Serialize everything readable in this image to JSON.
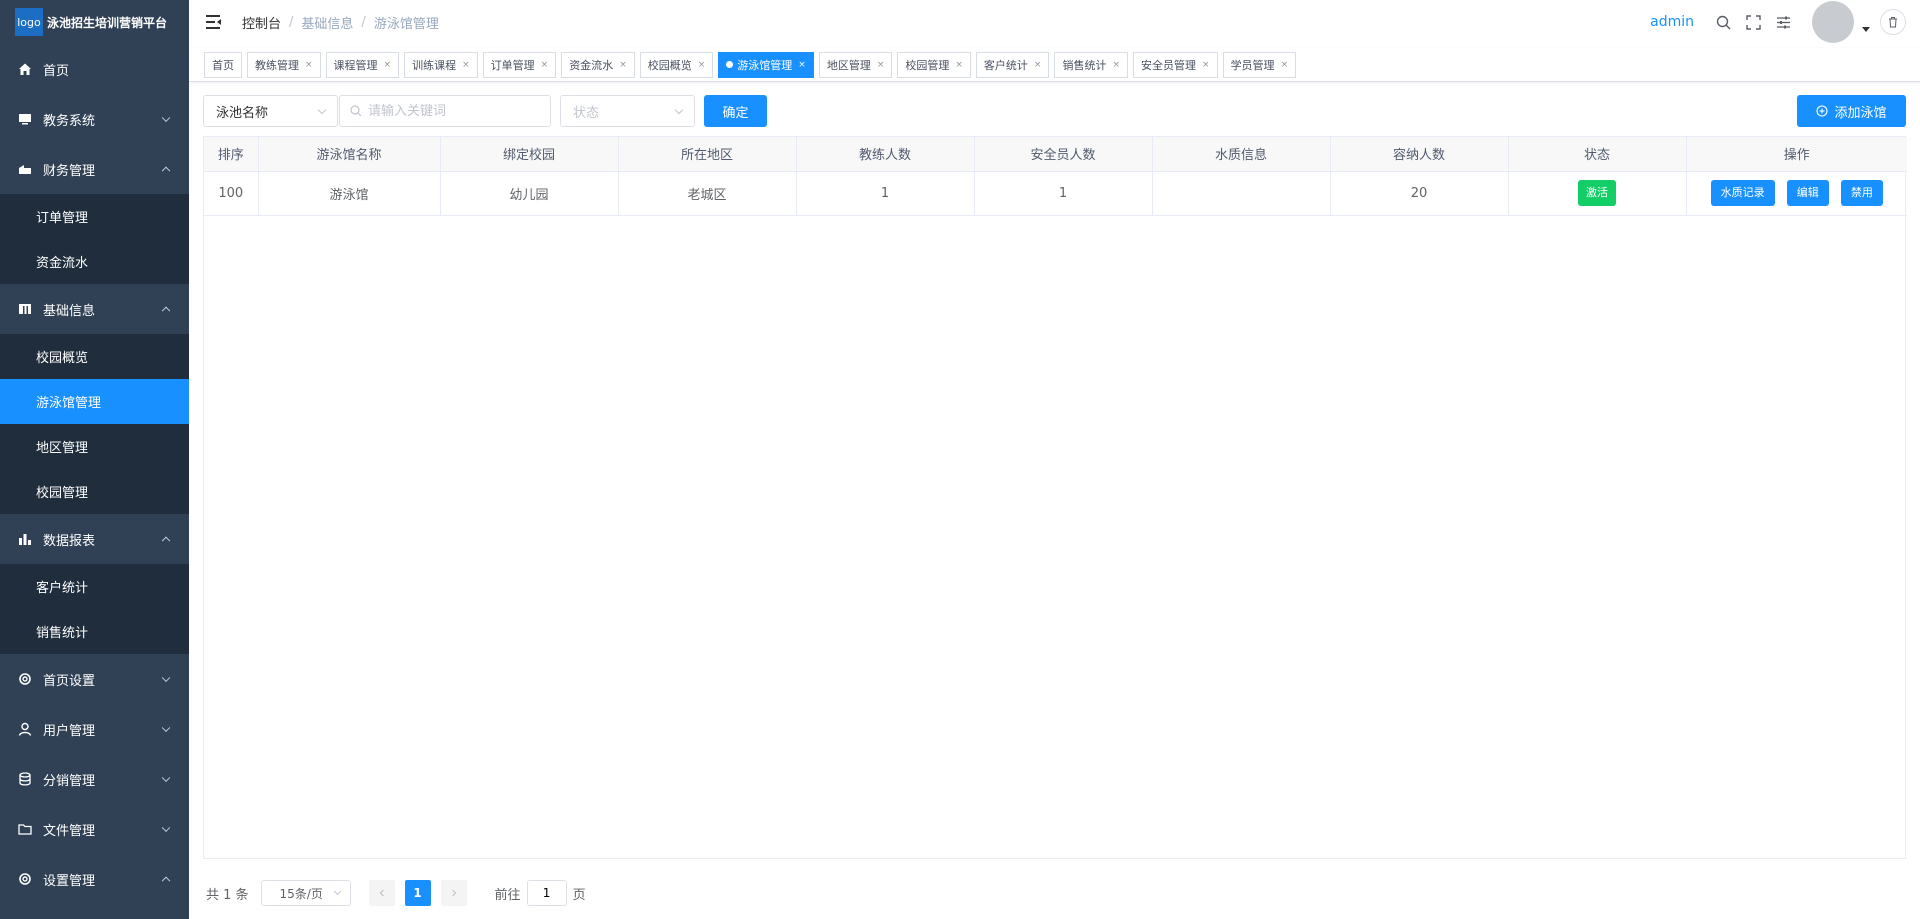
{
  "app": {
    "logo_text": "logo",
    "title": "泳池招生培训营销平台"
  },
  "sidebar": {
    "items": [
      {
        "label": "首页",
        "icon": "home-icon"
      },
      {
        "label": "教务系统",
        "icon": "monitor-icon",
        "expanded": false
      },
      {
        "label": "财务管理",
        "icon": "finance-icon",
        "expanded": true,
        "children": [
          "订单管理",
          "资金流水"
        ]
      },
      {
        "label": "基础信息",
        "icon": "building-icon",
        "expanded": true,
        "children": [
          "校园概览",
          "游泳馆管理",
          "地区管理",
          "校园管理"
        ],
        "active_child": "游泳馆管理"
      },
      {
        "label": "数据报表",
        "icon": "bar-chart-icon",
        "expanded": true,
        "children": [
          "客户统计",
          "销售统计"
        ]
      },
      {
        "label": "首页设置",
        "icon": "gear-icon",
        "expanded": false
      },
      {
        "label": "用户管理",
        "icon": "user-icon",
        "expanded": false
      },
      {
        "label": "分销管理",
        "icon": "database-icon",
        "expanded": false
      },
      {
        "label": "文件管理",
        "icon": "folder-icon",
        "expanded": false
      },
      {
        "label": "设置管理",
        "icon": "settings-icon",
        "expanded": true
      }
    ]
  },
  "navbar": {
    "breadcrumb": [
      "控制台",
      "基础信息",
      "游泳馆管理"
    ],
    "username": "admin"
  },
  "tags": [
    {
      "label": "首页",
      "closable": false
    },
    {
      "label": "教练管理",
      "closable": true
    },
    {
      "label": "课程管理",
      "closable": true
    },
    {
      "label": "训练课程",
      "closable": true
    },
    {
      "label": "订单管理",
      "closable": true
    },
    {
      "label": "资金流水",
      "closable": true
    },
    {
      "label": "校园概览",
      "closable": true
    },
    {
      "label": "游泳馆管理",
      "closable": true,
      "active": true
    },
    {
      "label": "地区管理",
      "closable": true
    },
    {
      "label": "校园管理",
      "closable": true
    },
    {
      "label": "客户统计",
      "closable": true
    },
    {
      "label": "销售统计",
      "closable": true
    },
    {
      "label": "安全员管理",
      "closable": true
    },
    {
      "label": "学员管理",
      "closable": true
    }
  ],
  "filters": {
    "pool_select": "泳池名称",
    "keyword_placeholder": "请输入关键词",
    "status_placeholder": "状态",
    "confirm_label": "确定",
    "add_label": "添加泳馆"
  },
  "table": {
    "headers": [
      "排序",
      "游泳馆名称",
      "绑定校园",
      "所在地区",
      "教练人数",
      "安全员人数",
      "水质信息",
      "容纳人数",
      "状态",
      "操作"
    ],
    "rows": [
      {
        "sort": "100",
        "name": "游泳馆",
        "campus": "幼儿园",
        "region": "老城区",
        "coaches": "1",
        "safety": "1",
        "water": "",
        "capacity": "20",
        "status": "激活"
      }
    ],
    "actions": [
      "水质记录",
      "编辑",
      "禁用"
    ]
  },
  "pagination": {
    "total_text": "共 1 条",
    "page_size": "15条/页",
    "current_page": "1",
    "goto_label": "前往",
    "goto_value": "1",
    "page_suffix": "页"
  },
  "colors": {
    "sidebar_bg": "#304156",
    "submenu_bg": "#1f2d3d",
    "primary": "#1890ff",
    "success": "#13ce66"
  }
}
